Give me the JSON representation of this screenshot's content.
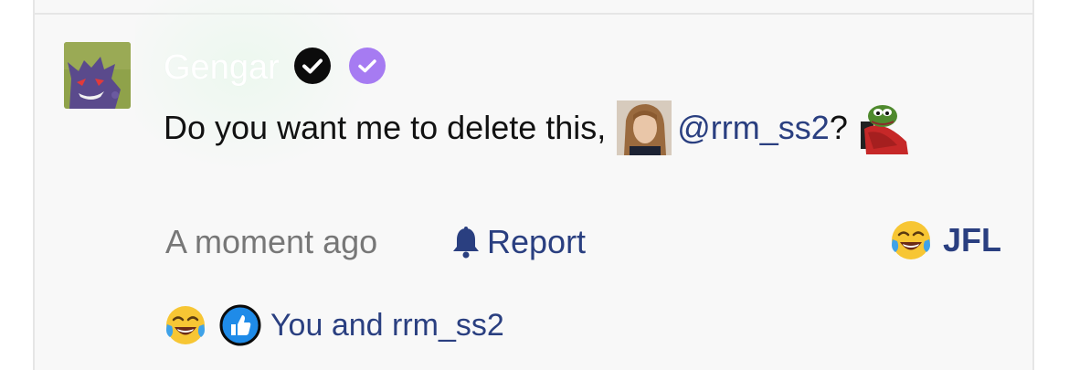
{
  "comment": {
    "author": "Gengar",
    "message_prefix": "Do you want me to delete this,",
    "mention": "@rrm_ss2",
    "message_suffix": "?",
    "timestamp": "A moment ago",
    "report_label": "Report",
    "reaction_label": "JFL",
    "reactions_summary": "You and rrm_ss2",
    "icons": {
      "verified_black": "check-circle-icon",
      "verified_purple": "check-circle-icon",
      "report": "bell-icon",
      "reaction": "joy-emoji-icon",
      "like": "thumbs-up-icon"
    },
    "colors": {
      "link": "#2a3f80",
      "muted": "#777777",
      "badge_purple": "#a67bf2",
      "badge_black": "#0c0c0c"
    }
  }
}
